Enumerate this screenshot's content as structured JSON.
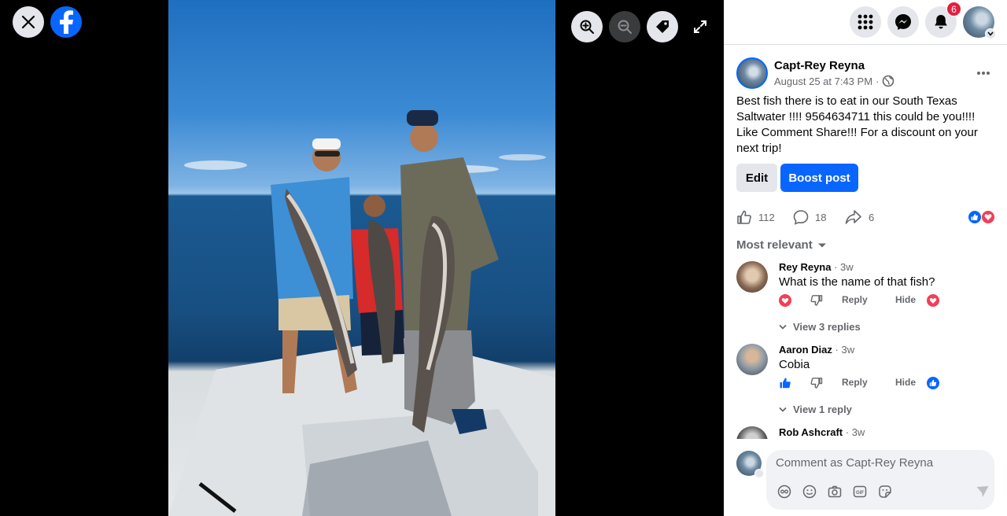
{
  "viewer": {
    "close_icon": "close-icon",
    "logo_icon": "facebook-logo",
    "tools": [
      "zoom-in-icon",
      "zoom-out-icon",
      "tag-icon",
      "expand-icon"
    ]
  },
  "topbar": {
    "icons": [
      "menu-grid-icon",
      "messenger-icon",
      "bell-icon"
    ],
    "notification_count": "6"
  },
  "post": {
    "author": "Capt-Rey Reyna",
    "date": "August 25 at 7:43 PM",
    "separator": "·",
    "privacy_icon": "globe-icon",
    "text": "Best fish there is to eat in our South Texas Saltwater !!!! 9564634711 this could be you!!!! Like Comment Share!!! For a discount on your next trip!",
    "edit_label": "Edit",
    "boost_label": "Boost post",
    "likes": "112",
    "comments": "18",
    "shares": "6",
    "reaction_icons": [
      "like-reaction-icon",
      "love-reaction-icon"
    ]
  },
  "comments": {
    "sort_label": "Most relevant",
    "items": [
      {
        "name": "Rey Reyna",
        "time": "· 3w",
        "text": "What is the name of that fish?",
        "reply": "Reply",
        "hide": "Hide",
        "view_replies": "View 3 replies",
        "reaction": "love"
      },
      {
        "name": "Aaron Diaz",
        "time": "· 3w",
        "text": "Cobia",
        "reply": "Reply",
        "hide": "Hide",
        "view_replies": "View 1 reply",
        "reaction": "like"
      },
      {
        "name": "Rob Ashcraft",
        "time": "· 3w",
        "text": "",
        "reply": "",
        "hide": "",
        "view_replies": "",
        "reaction": ""
      }
    ]
  },
  "composer": {
    "placeholder": "Comment as Capt-Rey Reyna",
    "tools": [
      "avatar-sticker-icon",
      "emoji-icon",
      "camera-icon",
      "gif-icon",
      "sticker-icon",
      "send-icon"
    ]
  },
  "colors": {
    "accent": "#0866ff",
    "badge": "#e41e3f",
    "love": "#f33e58",
    "muted": "#65676b"
  }
}
